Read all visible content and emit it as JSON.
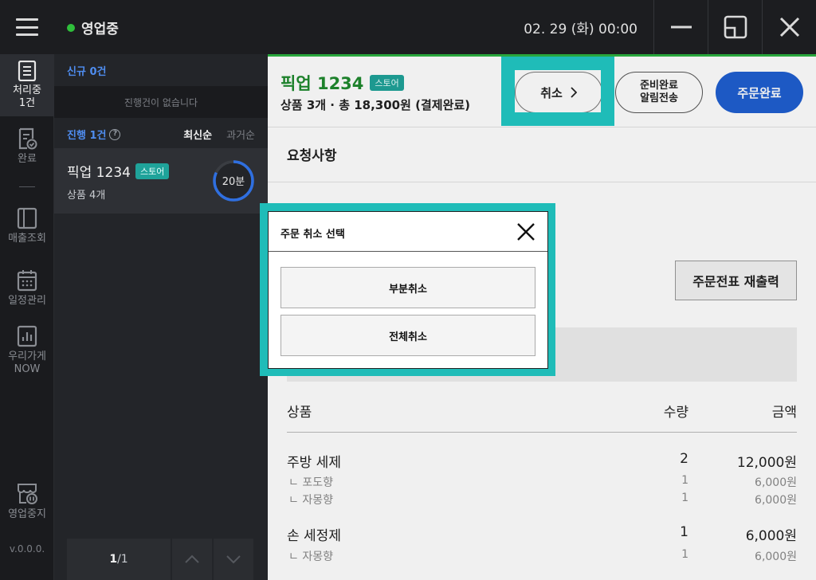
{
  "topbar": {
    "status": "영업중",
    "datetime": "02. 29 (화) 00:00",
    "colors": {
      "status_dot": "#2fbf3b",
      "accent_teal": "#1fbcb8",
      "primary_blue": "#1f5fd1",
      "pickup_green": "#1f8a2e"
    }
  },
  "leftnav": {
    "items": [
      {
        "label": "처리중\n1건",
        "icon": "document-list-icon",
        "active": true
      },
      {
        "label": "완료",
        "icon": "document-check-icon",
        "active": false
      },
      {
        "label": "매출조회",
        "icon": "ledger-icon",
        "active": false
      },
      {
        "label": "일정관리",
        "icon": "calendar-icon",
        "active": false
      },
      {
        "label": "우리가게\nNOW",
        "icon": "bar-chart-icon",
        "active": false
      },
      {
        "label": "영업중지",
        "icon": "store-pause-icon",
        "active": false
      }
    ],
    "version": "v.0.0.0."
  },
  "orderlist": {
    "new_header": "신규 0건",
    "new_empty": "진행건이 없습니다",
    "progress_header": "진행 1건",
    "sort_recent": "최신순",
    "sort_past": "과거순",
    "card": {
      "title": "픽업 1234",
      "tag": "스토어",
      "subtitle": "상품 4개",
      "timer": "20분",
      "timer_progress": 0.82
    },
    "pager": {
      "current": "1",
      "total": "/1"
    }
  },
  "detail": {
    "title": "픽업 1234",
    "tag": "스토어",
    "subtitle": "상품 3개 · 총 18,300원 (결제완료)",
    "cancel_label": "취소",
    "ready_label": "준비완료\n알림전송",
    "complete_label": "주문완료",
    "request_title": "요청사항",
    "reprint_label": "주문전표 재출력",
    "items_header": {
      "name": "상품",
      "qty": "수량",
      "price": "금액"
    },
    "items": [
      {
        "name": "주방 세제",
        "qty": "2",
        "price": "12,000원",
        "options": [
          {
            "name": "ㄴ 포도향",
            "qty": "1",
            "price": "6,000원"
          },
          {
            "name": "ㄴ 자몽향",
            "qty": "1",
            "price": "6,000원"
          }
        ]
      },
      {
        "name": "손 세정제",
        "qty": "1",
        "price": "6,000원",
        "options": [
          {
            "name": "ㄴ 자몽향",
            "qty": "1",
            "price": "6,000원"
          }
        ]
      }
    ]
  },
  "modal": {
    "title": "주문 취소 선택",
    "partial_label": "부분취소",
    "full_label": "전체취소"
  }
}
